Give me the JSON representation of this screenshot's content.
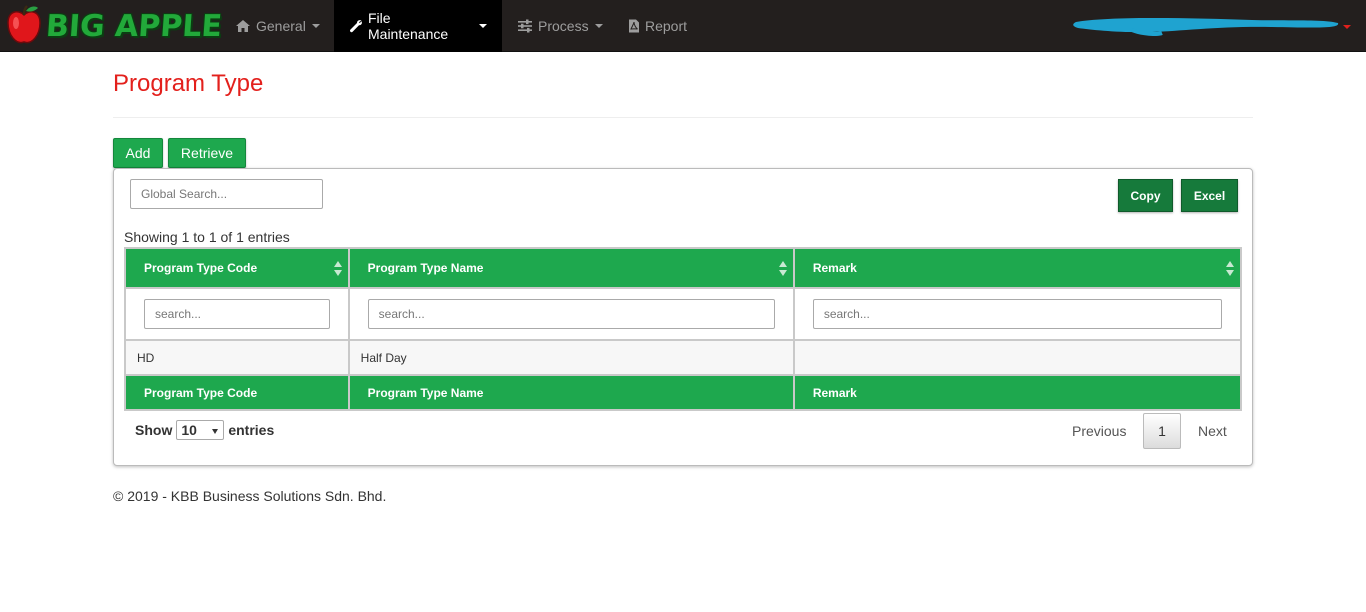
{
  "brand": {
    "name": "BIG APPLE",
    "logo_icon": "apple-icon"
  },
  "nav": {
    "items": [
      {
        "label": "General",
        "icon": "home-icon",
        "dropdown": true
      },
      {
        "label": "File Maintenance",
        "icon": "wrench-icon",
        "dropdown": true,
        "active": true
      },
      {
        "label": "Process",
        "icon": "sliders-icon",
        "dropdown": true
      },
      {
        "label": "Report",
        "icon": "pdf-file-icon",
        "dropdown": false
      }
    ],
    "user_menu": {
      "label": "",
      "redacted": true,
      "dropdown": true
    }
  },
  "page": {
    "title": "Program Type"
  },
  "actions": {
    "add_label": "Add",
    "retrieve_label": "Retrieve"
  },
  "table_tools": {
    "global_search_placeholder": "Global Search...",
    "copy_label": "Copy",
    "excel_label": "Excel",
    "info": "Showing 1 to 1 of 1 entries"
  },
  "table": {
    "columns": [
      "Program Type Code",
      "Program Type Name",
      "Remark"
    ],
    "filter_placeholder": "search...",
    "rows": [
      [
        "HD",
        "Half Day",
        ""
      ]
    ]
  },
  "length_menu": {
    "prefix": "Show",
    "value": "10",
    "suffix": "entries"
  },
  "pagination": {
    "previous": "Previous",
    "current": "1",
    "next": "Next"
  },
  "footer": {
    "text": "© 2019 - KBB Business Solutions Sdn. Bhd."
  },
  "colors": {
    "navbar": "#231f1e",
    "accent_green": "#1ea84e",
    "title_red": "#e3201c",
    "dark_green": "#167a3b"
  }
}
